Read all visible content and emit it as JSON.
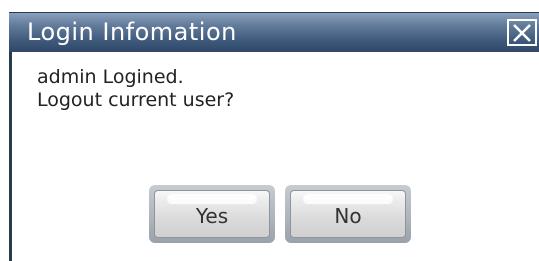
{
  "dialog": {
    "title": "Login Infomation",
    "close_icon": "close-icon",
    "message_line1": "admin Logined.",
    "message_line2": "Logout current user?",
    "yes_label": "Yes",
    "no_label": "No"
  },
  "colors": {
    "title_bar": "#3f5a7c",
    "title_text": "#ffffff",
    "background": "#ffffff",
    "button_face": "#dcdcdc"
  }
}
